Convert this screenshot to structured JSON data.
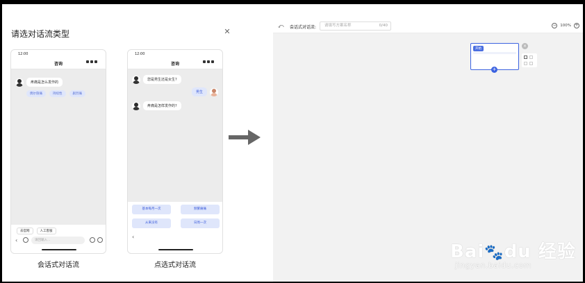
{
  "modal": {
    "title": "请选对话流类型",
    "close_icon": "close-icon"
  },
  "phone_conversation": {
    "time": "12:00",
    "nav_title": "咨询",
    "bot_message": "疼痛是怎么发作的",
    "chips": [
      "偶尔隐痛",
      "持续性",
      "剧烈痛"
    ],
    "quick_tabs": [
      "去官网",
      "人工客服"
    ],
    "input_placeholder": "请回输入...",
    "label": "会话式对话流"
  },
  "phone_choice": {
    "time": "12:00",
    "nav_title": "咨询",
    "bot_message_1": "您是男生还是女生?",
    "user_reply": "男生",
    "bot_message_2": "疼痛是怎样发作的?",
    "options": [
      "基本每月一次",
      "频繁痛痛",
      "从来没有",
      "日周一次"
    ],
    "label": "点选式对话流"
  },
  "editor": {
    "flow_label": "会话式对话流:",
    "name_placeholder": "请填写方案名称",
    "name_count": "0/40",
    "zoom_level": "100%",
    "node_tag": "开始"
  },
  "watermark": {
    "brand": "Bai  du 经验",
    "url": "jingyan.baidu.com"
  },
  "colors": {
    "accent": "#3b62e0",
    "chip_bg": "#dfe6fb",
    "canvas": "#f2f2f2"
  }
}
